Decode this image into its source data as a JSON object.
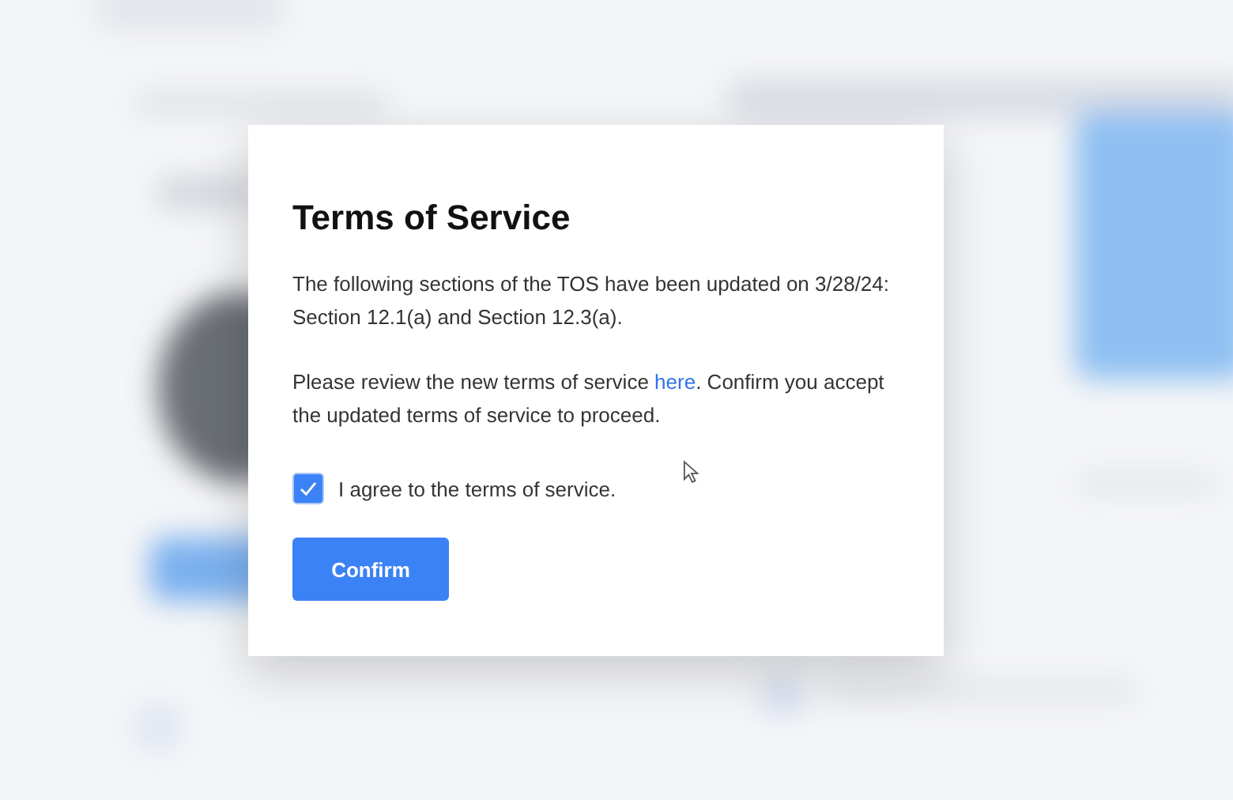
{
  "dialog": {
    "title": "Terms of Service",
    "paragraphs": [
      {
        "text": "The following sections of the TOS have been updated on 3/28/24: Section 12.1(a) and Section 12.3(a)."
      },
      {
        "before": "Please review the new terms of service ",
        "link": "here",
        "after": ". Confirm you accept the updated terms of service to proceed."
      }
    ],
    "checkbox": {
      "label": "I agree to the terms of service.",
      "checked": true
    },
    "button": {
      "label": "Confirm"
    }
  }
}
